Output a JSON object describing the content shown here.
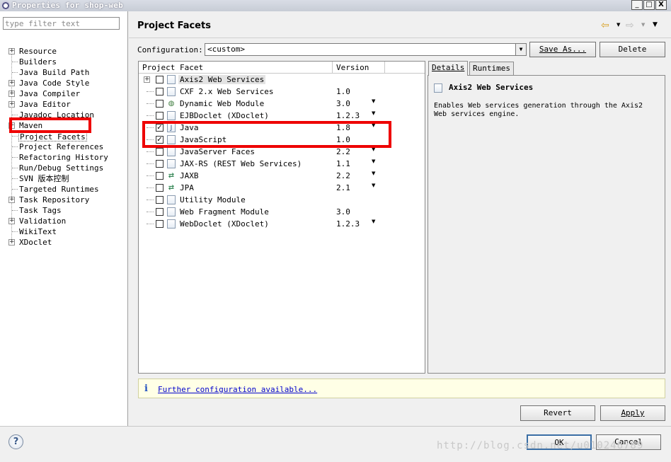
{
  "window": {
    "title": "Properties for shop-web",
    "minimize": "_",
    "maximize": "□",
    "close": "X"
  },
  "filter": {
    "placeholder": "type filter text"
  },
  "tree": [
    {
      "label": "Resource",
      "expandable": true
    },
    {
      "label": "Builders",
      "expandable": false
    },
    {
      "label": "Java Build Path",
      "expandable": false
    },
    {
      "label": "Java Code Style",
      "expandable": true
    },
    {
      "label": "Java Compiler",
      "expandable": true
    },
    {
      "label": "Java Editor",
      "expandable": true
    },
    {
      "label": "Javadoc Location",
      "expandable": false
    },
    {
      "label": "Maven",
      "expandable": true
    },
    {
      "label": "Project Facets",
      "expandable": false,
      "selected": true
    },
    {
      "label": "Project References",
      "expandable": false
    },
    {
      "label": "Refactoring History",
      "expandable": false
    },
    {
      "label": "Run/Debug Settings",
      "expandable": false
    },
    {
      "label": "SVN 版本控制",
      "expandable": false
    },
    {
      "label": "Targeted Runtimes",
      "expandable": false
    },
    {
      "label": "Task Repository",
      "expandable": true
    },
    {
      "label": "Task Tags",
      "expandable": false
    },
    {
      "label": "Validation",
      "expandable": true
    },
    {
      "label": "WikiText",
      "expandable": false
    },
    {
      "label": "XDoclet",
      "expandable": true
    }
  ],
  "page": {
    "title": "Project Facets"
  },
  "nav": {
    "back_icon": "back-arrow-icon",
    "forward_icon": "forward-arrow-icon",
    "menu_icon": "view-menu-icon"
  },
  "configuration": {
    "label": "Configuration:",
    "value": "<custom>",
    "save_as": "Save As...",
    "delete": "Delete"
  },
  "facets": {
    "col_facet": "Project Facet",
    "col_version": "Version",
    "rows": [
      {
        "name": "Axis2 Web Services",
        "version": "",
        "checked": false,
        "dropdown": false,
        "icon": "doc",
        "expandable": true,
        "selected": true
      },
      {
        "name": "CXF 2.x Web Services",
        "version": "1.0",
        "checked": false,
        "dropdown": false,
        "icon": "doc"
      },
      {
        "name": "Dynamic Web Module",
        "version": "3.0",
        "checked": false,
        "dropdown": true,
        "icon": "globe"
      },
      {
        "name": "EJBDoclet (XDoclet)",
        "version": "1.2.3",
        "checked": false,
        "dropdown": true,
        "icon": "doc"
      },
      {
        "name": "Java",
        "version": "1.8",
        "checked": true,
        "dropdown": true,
        "icon": "java"
      },
      {
        "name": "JavaScript",
        "version": "1.0",
        "checked": true,
        "dropdown": false,
        "icon": "doc"
      },
      {
        "name": "JavaServer Faces",
        "version": "2.2",
        "checked": false,
        "dropdown": true,
        "icon": "doc"
      },
      {
        "name": "JAX-RS (REST Web Services)",
        "version": "1.1",
        "checked": false,
        "dropdown": true,
        "icon": "doc"
      },
      {
        "name": "JAXB",
        "version": "2.2",
        "checked": false,
        "dropdown": true,
        "icon": "arrows"
      },
      {
        "name": "JPA",
        "version": "2.1",
        "checked": false,
        "dropdown": true,
        "icon": "arrows"
      },
      {
        "name": "Utility Module",
        "version": "",
        "checked": false,
        "dropdown": false,
        "icon": "doc"
      },
      {
        "name": "Web Fragment Module",
        "version": "3.0",
        "checked": false,
        "dropdown": false,
        "icon": "doc"
      },
      {
        "name": "WebDoclet (XDoclet)",
        "version": "1.2.3",
        "checked": false,
        "dropdown": true,
        "icon": "doc"
      }
    ]
  },
  "details": {
    "tab_details": "Details",
    "tab_runtimes": "Runtimes",
    "title": "Axis2 Web Services",
    "description": "Enables Web services generation through the Axis2 Web services engine."
  },
  "info": {
    "link": "Further configuration available..."
  },
  "buttons": {
    "revert": "Revert",
    "apply": "Apply",
    "ok": "OK",
    "cancel": "Cancel"
  },
  "watermark": "http://blog.csdn.net/u010246789"
}
